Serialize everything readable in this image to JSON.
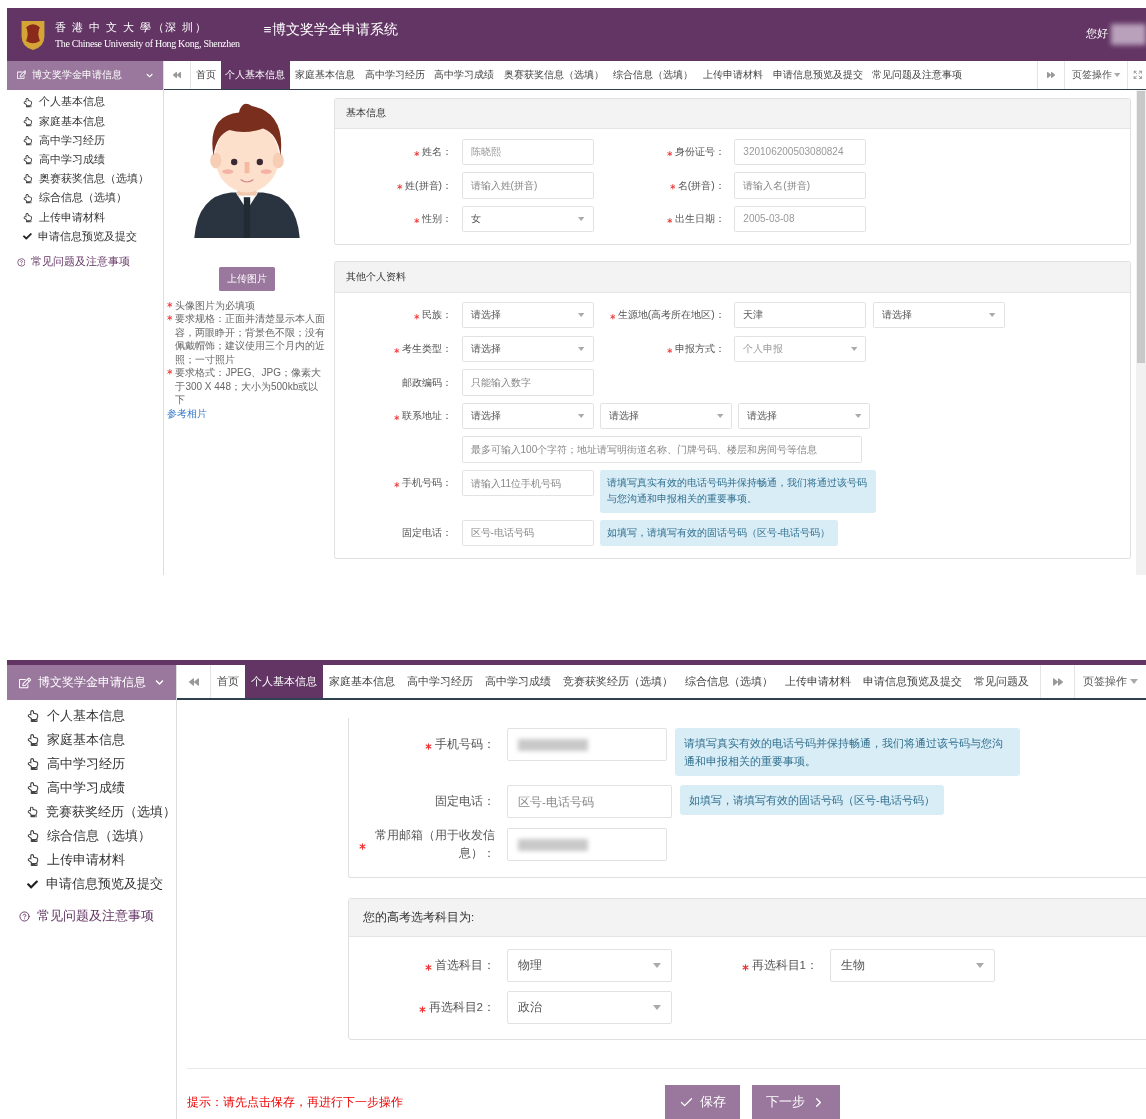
{
  "top": {
    "header": {
      "logo_cn": "香 港 中 文 大 學（深 圳）",
      "logo_en": "The Chinese University of Hong Kong, Shenzhen",
      "title": "≡博文奖学金申请系统",
      "greeting": "您好"
    },
    "sidebar": {
      "title": "博文奖学金申请信息",
      "items": [
        {
          "label": "个人基本信息",
          "kind": "pointer"
        },
        {
          "label": "家庭基本信息",
          "kind": "pointer"
        },
        {
          "label": "高中学习经历",
          "kind": "pointer"
        },
        {
          "label": "高中学习成绩",
          "kind": "pointer"
        },
        {
          "label": "奥赛获奖信息（选填）",
          "kind": "pointer"
        },
        {
          "label": "综合信息（选填）",
          "kind": "pointer"
        },
        {
          "label": "上传申请材料",
          "kind": "pointer"
        },
        {
          "label": "申请信息预览及提交",
          "kind": "check"
        }
      ],
      "help": "常见问题及注意事项"
    },
    "tabs": [
      {
        "label": "首页",
        "selected": false
      },
      {
        "label": "个人基本信息",
        "selected": true
      },
      {
        "label": "家庭基本信息",
        "selected": false
      },
      {
        "label": "高中学习经历",
        "selected": false
      },
      {
        "label": "高中学习成绩",
        "selected": false
      },
      {
        "label": "奥赛获奖信息（选填）",
        "selected": false
      },
      {
        "label": "综合信息（选填）",
        "selected": false
      },
      {
        "label": "上传申请材料",
        "selected": false
      },
      {
        "label": "申请信息预览及提交",
        "selected": false
      },
      {
        "label": "常见问题及注意事项",
        "selected": false
      }
    ],
    "tab_menu": "页签操作",
    "photo": {
      "upload": "上传图片",
      "notes": [
        "头像图片为必填项",
        "要求规格：正面并清楚显示本人面容，两眼睁开；背景色不限；没有佩戴帽饰；建议使用三个月内的近照；一寸照片",
        "要求格式：JPEG、JPG；像素大于300 X 448；大小为500kb或以下"
      ],
      "link": "参考相片"
    },
    "sections": [
      {
        "title": "基本信息",
        "rows": [
          {
            "groups": [
              {
                "label": "姓名：",
                "required": true,
                "controls": [
                  {
                    "kind": "input",
                    "value": "陈晓熙",
                    "disabled": true
                  }
                ]
              },
              {
                "label": "身份证号：",
                "required": true,
                "controls": [
                  {
                    "kind": "input",
                    "value": "320106200503080824",
                    "disabled": true
                  }
                ]
              }
            ]
          },
          {
            "groups": [
              {
                "label": "姓(拼音)：",
                "required": true,
                "controls": [
                  {
                    "kind": "input",
                    "placeholder": "请输入姓(拼音)"
                  }
                ]
              },
              {
                "label": "名(拼音)：",
                "required": true,
                "controls": [
                  {
                    "kind": "input",
                    "placeholder": "请输入名(拼音)"
                  }
                ]
              }
            ]
          },
          {
            "groups": [
              {
                "label": "性别：",
                "required": true,
                "controls": [
                  {
                    "kind": "select",
                    "value": "女"
                  }
                ]
              },
              {
                "label": "出生日期：",
                "required": true,
                "controls": [
                  {
                    "kind": "input",
                    "value": "2005-03-08",
                    "disabled": true
                  }
                ]
              }
            ]
          }
        ]
      },
      {
        "title": "其他个人资料",
        "rows": [
          {
            "groups": [
              {
                "label": "民族：",
                "required": true,
                "controls": [
                  {
                    "kind": "select",
                    "value": "请选择"
                  }
                ]
              },
              {
                "label": "生源地(高考所在地区)：",
                "required": true,
                "controls": [
                  {
                    "kind": "input",
                    "value": "天津"
                  },
                  {
                    "kind": "select",
                    "value": "请选择"
                  }
                ]
              }
            ]
          },
          {
            "groups": [
              {
                "label": "考生类型：",
                "required": true,
                "controls": [
                  {
                    "kind": "select",
                    "value": "请选择"
                  }
                ]
              },
              {
                "label": "申报方式：",
                "required": true,
                "controls": [
                  {
                    "kind": "select",
                    "value": "个人申报",
                    "disabled": true
                  }
                ]
              }
            ]
          },
          {
            "groups": [
              {
                "label": "邮政编码：",
                "required": false,
                "controls": [
                  {
                    "kind": "input",
                    "placeholder": "只能输入数字"
                  }
                ]
              }
            ]
          },
          {
            "groups": [
              {
                "label": "联系地址：",
                "required": true,
                "controls": [
                  {
                    "kind": "select",
                    "value": "请选择"
                  },
                  {
                    "kind": "select",
                    "value": "请选择"
                  },
                  {
                    "kind": "select",
                    "value": "请选择"
                  }
                ]
              }
            ]
          },
          {
            "groups": [
              {
                "required": false,
                "controls": [
                  {
                    "kind": "wide_input",
                    "placeholder": "最多可输入100个字符；地址请写明街道名称、门牌号码、楼层和房间号等信息"
                  }
                ]
              }
            ]
          },
          {
            "groups": [
              {
                "label": "手机号码：",
                "required": true,
                "controls": [
                  {
                    "kind": "input",
                    "placeholder": "请输入11位手机号码"
                  }
                ]
              }
            ],
            "hint": "请填写真实有效的电话号码并保持畅通，我们将通过该号码与您沟通和申报相关的重要事项。"
          },
          {
            "groups": [
              {
                "label": "固定电话：",
                "required": false,
                "controls": [
                  {
                    "kind": "input",
                    "placeholder": "区号-电话号码"
                  }
                ]
              }
            ],
            "hint": "如填写，请填写有效的固话号码（区号-电话号码）"
          }
        ]
      }
    ]
  },
  "bottom": {
    "sidebar": {
      "title": "博文奖学金申请信息",
      "items": [
        {
          "label": "个人基本信息",
          "kind": "pointer"
        },
        {
          "label": "家庭基本信息",
          "kind": "pointer"
        },
        {
          "label": "高中学习经历",
          "kind": "pointer"
        },
        {
          "label": "高中学习成绩",
          "kind": "pointer"
        },
        {
          "label": "竞赛获奖经历（选填）",
          "kind": "pointer"
        },
        {
          "label": "综合信息（选填）",
          "kind": "pointer"
        },
        {
          "label": "上传申请材料",
          "kind": "pointer"
        },
        {
          "label": "申请信息预览及提交",
          "kind": "check"
        }
      ],
      "help": "常见问题及注意事项"
    },
    "tabs": [
      {
        "label": "首页",
        "selected": false
      },
      {
        "label": "个人基本信息",
        "selected": true
      },
      {
        "label": "家庭基本信息",
        "selected": false
      },
      {
        "label": "高中学习经历",
        "selected": false
      },
      {
        "label": "高中学习成绩",
        "selected": false
      },
      {
        "label": "竞赛获奖经历（选填）",
        "selected": false
      },
      {
        "label": "综合信息（选填）",
        "selected": false
      },
      {
        "label": "上传申请材料",
        "selected": false
      },
      {
        "label": "申请信息预览及提交",
        "selected": false
      },
      {
        "label": "常见问题及",
        "selected": false
      }
    ],
    "tab_menu": "页签操作",
    "sections": [
      {
        "rows": [
          {
            "groups": [
              {
                "label": "手机号码：",
                "required": true,
                "controls": [
                  {
                    "kind": "masked"
                  }
                ]
              }
            ],
            "hint": "请填写真实有效的电话号码并保持畅通，我们将通过该号码与您沟通和申报相关的重要事项。"
          },
          {
            "groups": [
              {
                "label": "固定电话：",
                "required": false,
                "controls": [
                  {
                    "kind": "input",
                    "placeholder": "区号-电话号码"
                  }
                ]
              }
            ],
            "hint": "如填写，请填写有效的固话号码（区号-电话号码）"
          },
          {
            "groups": [
              {
                "label": "常用邮箱（用于收发信息）：",
                "required": true,
                "controls": [
                  {
                    "kind": "masked"
                  }
                ]
              }
            ]
          }
        ]
      },
      {
        "title": "您的高考选考科目为:",
        "rows": [
          {
            "groups": [
              {
                "label": "首选科目：",
                "required": true,
                "controls": [
                  {
                    "kind": "select",
                    "value": "物理"
                  }
                ]
              },
              {
                "label": "再选科目1：",
                "required": true,
                "controls": [
                  {
                    "kind": "select",
                    "value": "生物"
                  }
                ]
              }
            ]
          },
          {
            "groups": [
              {
                "label": "再选科目2：",
                "required": true,
                "controls": [
                  {
                    "kind": "select",
                    "value": "政治"
                  }
                ]
              }
            ]
          }
        ]
      }
    ],
    "tip": "提示：请先点击保存，再进行下一步操作",
    "buttons": [
      {
        "label": "保存",
        "kind": "save"
      },
      {
        "label": "下一步",
        "kind": "next"
      }
    ]
  }
}
